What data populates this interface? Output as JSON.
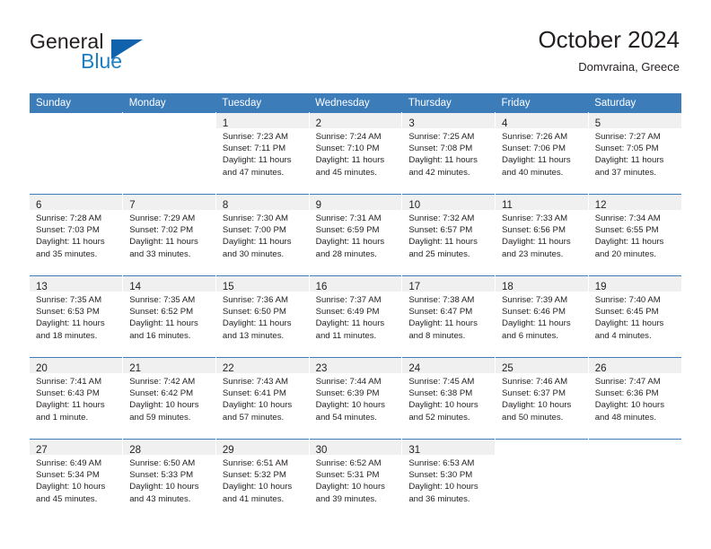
{
  "logo": {
    "word1": "General",
    "word2": "Blue",
    "triangle_color": "#1162ad",
    "blue_color": "#1c7fc4"
  },
  "header": {
    "title": "October 2024",
    "subtitle": "Domvraina, Greece",
    "accent_color": "#3c7cb9"
  },
  "weekdays": [
    "Sunday",
    "Monday",
    "Tuesday",
    "Wednesday",
    "Thursday",
    "Friday",
    "Saturday"
  ],
  "labels": {
    "sunrise_prefix": "Sunrise:",
    "sunset_prefix": "Sunset:",
    "daylight_prefix": "Daylight:"
  },
  "weeks": [
    [
      {
        "day": "",
        "lines": []
      },
      {
        "day": "",
        "lines": []
      },
      {
        "day": "1",
        "lines": [
          "Sunrise: 7:23 AM",
          "Sunset: 7:11 PM",
          "Daylight: 11 hours",
          "and 47 minutes."
        ]
      },
      {
        "day": "2",
        "lines": [
          "Sunrise: 7:24 AM",
          "Sunset: 7:10 PM",
          "Daylight: 11 hours",
          "and 45 minutes."
        ]
      },
      {
        "day": "3",
        "lines": [
          "Sunrise: 7:25 AM",
          "Sunset: 7:08 PM",
          "Daylight: 11 hours",
          "and 42 minutes."
        ]
      },
      {
        "day": "4",
        "lines": [
          "Sunrise: 7:26 AM",
          "Sunset: 7:06 PM",
          "Daylight: 11 hours",
          "and 40 minutes."
        ]
      },
      {
        "day": "5",
        "lines": [
          "Sunrise: 7:27 AM",
          "Sunset: 7:05 PM",
          "Daylight: 11 hours",
          "and 37 minutes."
        ]
      }
    ],
    [
      {
        "day": "6",
        "lines": [
          "Sunrise: 7:28 AM",
          "Sunset: 7:03 PM",
          "Daylight: 11 hours",
          "and 35 minutes."
        ]
      },
      {
        "day": "7",
        "lines": [
          "Sunrise: 7:29 AM",
          "Sunset: 7:02 PM",
          "Daylight: 11 hours",
          "and 33 minutes."
        ]
      },
      {
        "day": "8",
        "lines": [
          "Sunrise: 7:30 AM",
          "Sunset: 7:00 PM",
          "Daylight: 11 hours",
          "and 30 minutes."
        ]
      },
      {
        "day": "9",
        "lines": [
          "Sunrise: 7:31 AM",
          "Sunset: 6:59 PM",
          "Daylight: 11 hours",
          "and 28 minutes."
        ]
      },
      {
        "day": "10",
        "lines": [
          "Sunrise: 7:32 AM",
          "Sunset: 6:57 PM",
          "Daylight: 11 hours",
          "and 25 minutes."
        ]
      },
      {
        "day": "11",
        "lines": [
          "Sunrise: 7:33 AM",
          "Sunset: 6:56 PM",
          "Daylight: 11 hours",
          "and 23 minutes."
        ]
      },
      {
        "day": "12",
        "lines": [
          "Sunrise: 7:34 AM",
          "Sunset: 6:55 PM",
          "Daylight: 11 hours",
          "and 20 minutes."
        ]
      }
    ],
    [
      {
        "day": "13",
        "lines": [
          "Sunrise: 7:35 AM",
          "Sunset: 6:53 PM",
          "Daylight: 11 hours",
          "and 18 minutes."
        ]
      },
      {
        "day": "14",
        "lines": [
          "Sunrise: 7:35 AM",
          "Sunset: 6:52 PM",
          "Daylight: 11 hours",
          "and 16 minutes."
        ]
      },
      {
        "day": "15",
        "lines": [
          "Sunrise: 7:36 AM",
          "Sunset: 6:50 PM",
          "Daylight: 11 hours",
          "and 13 minutes."
        ]
      },
      {
        "day": "16",
        "lines": [
          "Sunrise: 7:37 AM",
          "Sunset: 6:49 PM",
          "Daylight: 11 hours",
          "and 11 minutes."
        ]
      },
      {
        "day": "17",
        "lines": [
          "Sunrise: 7:38 AM",
          "Sunset: 6:47 PM",
          "Daylight: 11 hours",
          "and 8 minutes."
        ]
      },
      {
        "day": "18",
        "lines": [
          "Sunrise: 7:39 AM",
          "Sunset: 6:46 PM",
          "Daylight: 11 hours",
          "and 6 minutes."
        ]
      },
      {
        "day": "19",
        "lines": [
          "Sunrise: 7:40 AM",
          "Sunset: 6:45 PM",
          "Daylight: 11 hours",
          "and 4 minutes."
        ]
      }
    ],
    [
      {
        "day": "20",
        "lines": [
          "Sunrise: 7:41 AM",
          "Sunset: 6:43 PM",
          "Daylight: 11 hours",
          "and 1 minute."
        ]
      },
      {
        "day": "21",
        "lines": [
          "Sunrise: 7:42 AM",
          "Sunset: 6:42 PM",
          "Daylight: 10 hours",
          "and 59 minutes."
        ]
      },
      {
        "day": "22",
        "lines": [
          "Sunrise: 7:43 AM",
          "Sunset: 6:41 PM",
          "Daylight: 10 hours",
          "and 57 minutes."
        ]
      },
      {
        "day": "23",
        "lines": [
          "Sunrise: 7:44 AM",
          "Sunset: 6:39 PM",
          "Daylight: 10 hours",
          "and 54 minutes."
        ]
      },
      {
        "day": "24",
        "lines": [
          "Sunrise: 7:45 AM",
          "Sunset: 6:38 PM",
          "Daylight: 10 hours",
          "and 52 minutes."
        ]
      },
      {
        "day": "25",
        "lines": [
          "Sunrise: 7:46 AM",
          "Sunset: 6:37 PM",
          "Daylight: 10 hours",
          "and 50 minutes."
        ]
      },
      {
        "day": "26",
        "lines": [
          "Sunrise: 7:47 AM",
          "Sunset: 6:36 PM",
          "Daylight: 10 hours",
          "and 48 minutes."
        ]
      }
    ],
    [
      {
        "day": "27",
        "lines": [
          "Sunrise: 6:49 AM",
          "Sunset: 5:34 PM",
          "Daylight: 10 hours",
          "and 45 minutes."
        ]
      },
      {
        "day": "28",
        "lines": [
          "Sunrise: 6:50 AM",
          "Sunset: 5:33 PM",
          "Daylight: 10 hours",
          "and 43 minutes."
        ]
      },
      {
        "day": "29",
        "lines": [
          "Sunrise: 6:51 AM",
          "Sunset: 5:32 PM",
          "Daylight: 10 hours",
          "and 41 minutes."
        ]
      },
      {
        "day": "30",
        "lines": [
          "Sunrise: 6:52 AM",
          "Sunset: 5:31 PM",
          "Daylight: 10 hours",
          "and 39 minutes."
        ]
      },
      {
        "day": "31",
        "lines": [
          "Sunrise: 6:53 AM",
          "Sunset: 5:30 PM",
          "Daylight: 10 hours",
          "and 36 minutes."
        ]
      },
      {
        "day": "",
        "lines": []
      },
      {
        "day": "",
        "lines": []
      }
    ]
  ]
}
